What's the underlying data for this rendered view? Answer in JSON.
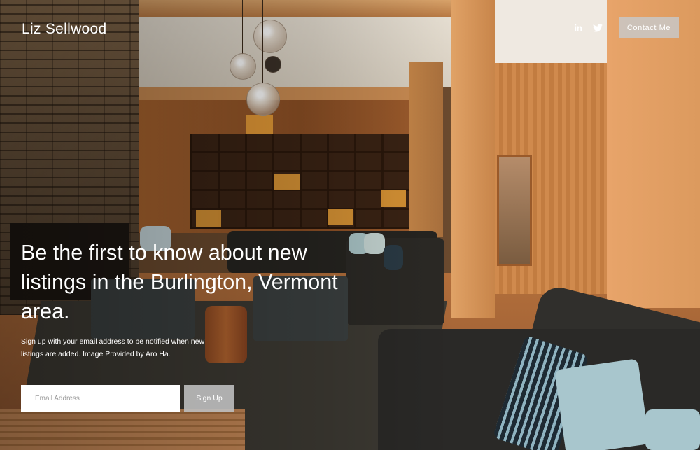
{
  "header": {
    "site_title": "Liz Sellwood",
    "social": [
      {
        "name": "linkedin",
        "icon": "linkedin-icon"
      },
      {
        "name": "twitter",
        "icon": "twitter-icon"
      }
    ],
    "contact_label": "Contact Me"
  },
  "hero": {
    "headline": "Be the first to know about new listings in the Burlington, Vermont area.",
    "description": "Sign up with your email address to be notified when new listings are added. Image Provided by Aro Ha."
  },
  "signup": {
    "email_placeholder": "Email Address",
    "button_label": "Sign Up"
  },
  "colors": {
    "text": "#ffffff",
    "button_bg": "#c8c8c8",
    "input_bg": "#ffffff"
  }
}
